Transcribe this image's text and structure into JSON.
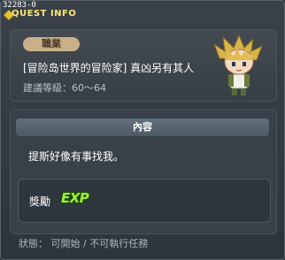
{
  "window": {
    "id_label": "32283-0",
    "title": "QUEST INFO"
  },
  "quest": {
    "job_badge": "職業",
    "title": "[冒险岛世界的冒险家] 真凶另有其人",
    "level_range": "建議等級：60～64",
    "npc_icon": "npc-portrait-icon"
  },
  "content": {
    "header": "內容",
    "text": "提斯好像有事找我。",
    "reward_label": "獎勵",
    "reward_icon_text": "EXP",
    "reward_color": "#9cf23a"
  },
  "status": {
    "text": "狀態： 可開始 / 不可執行任務"
  },
  "colors": {
    "title_accent": "#ffe87a",
    "badge_bg": "#c9b08a"
  }
}
